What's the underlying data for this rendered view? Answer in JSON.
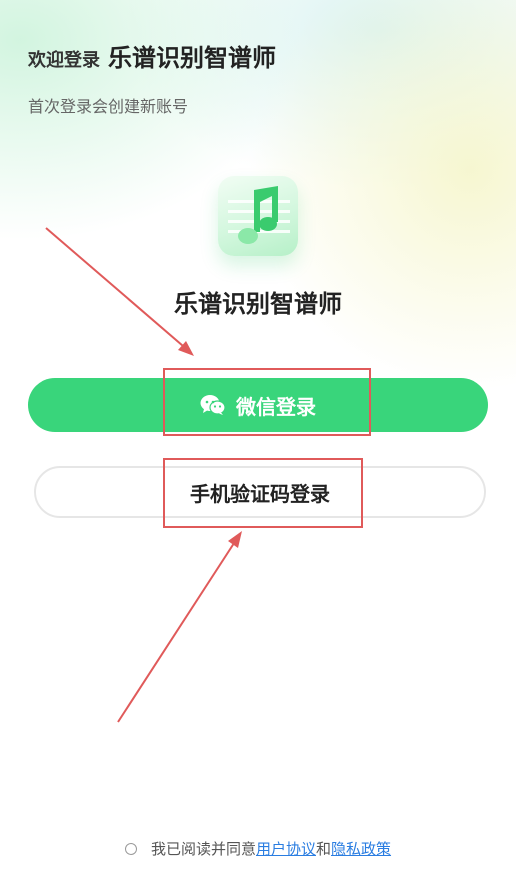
{
  "header": {
    "welcome": "欢迎登录",
    "app_name": "乐谱识别智谱师",
    "subtitle": "首次登录会创建新账号"
  },
  "logo": {
    "icon": "music-note-icon"
  },
  "app_title": "乐谱识别智谱师",
  "buttons": {
    "wechat_label": "微信登录",
    "wechat_icon": "wechat-icon",
    "phone_label": "手机验证码登录"
  },
  "agreement": {
    "prefix": "我已阅读并同意",
    "user_agreement": "用户协议",
    "conjunction": "和",
    "privacy_policy": "隐私政策"
  },
  "colors": {
    "primary": "#39d57b",
    "annotation": "#e05a5a",
    "link": "#2a7de1"
  }
}
